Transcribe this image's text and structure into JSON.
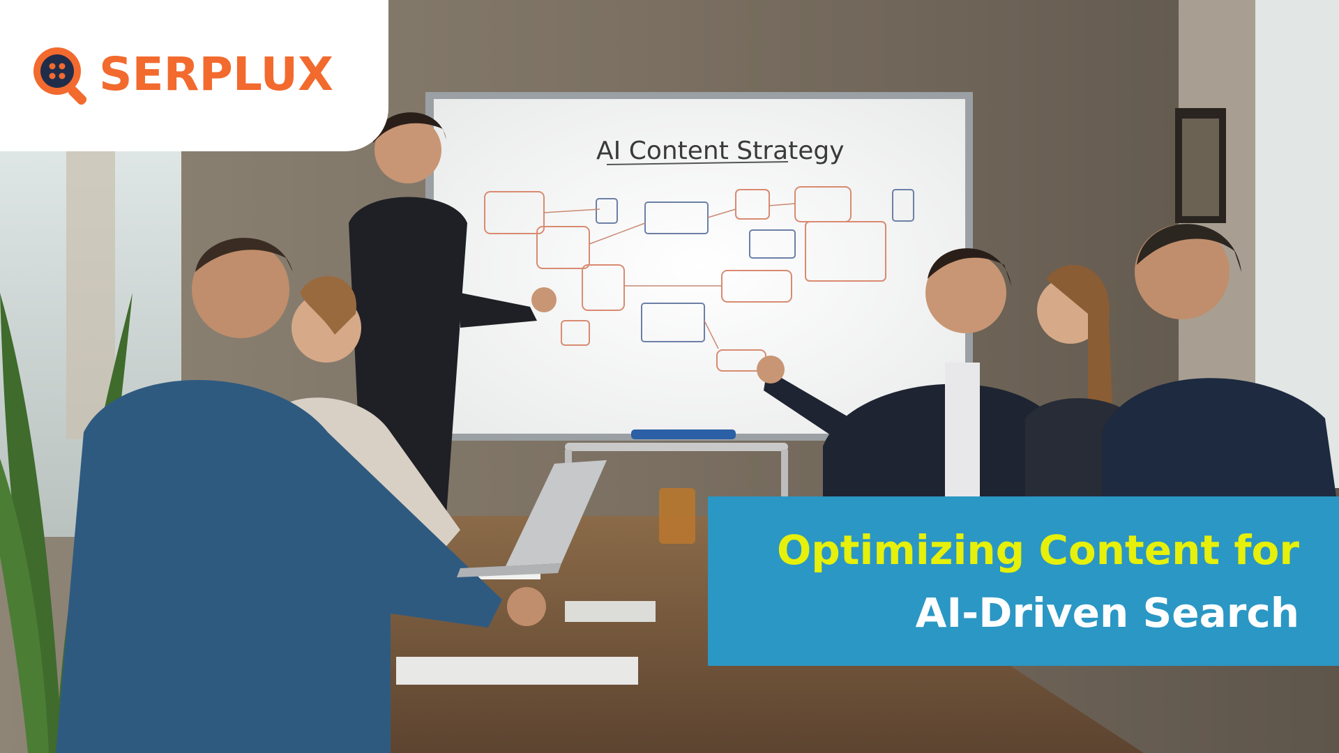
{
  "brand": {
    "name": "SERPLUX",
    "logo_icon": "magnifier-button-icon",
    "color": "#f26a2e"
  },
  "headline": {
    "line1": "Optimizing Content for",
    "line2": "AI-Driven Search",
    "line1_color": "#e6f00a",
    "line2_color": "#ffffff",
    "banner_color": "#2b97c4"
  },
  "whiteboard": {
    "title": "AI Content Strategy"
  }
}
